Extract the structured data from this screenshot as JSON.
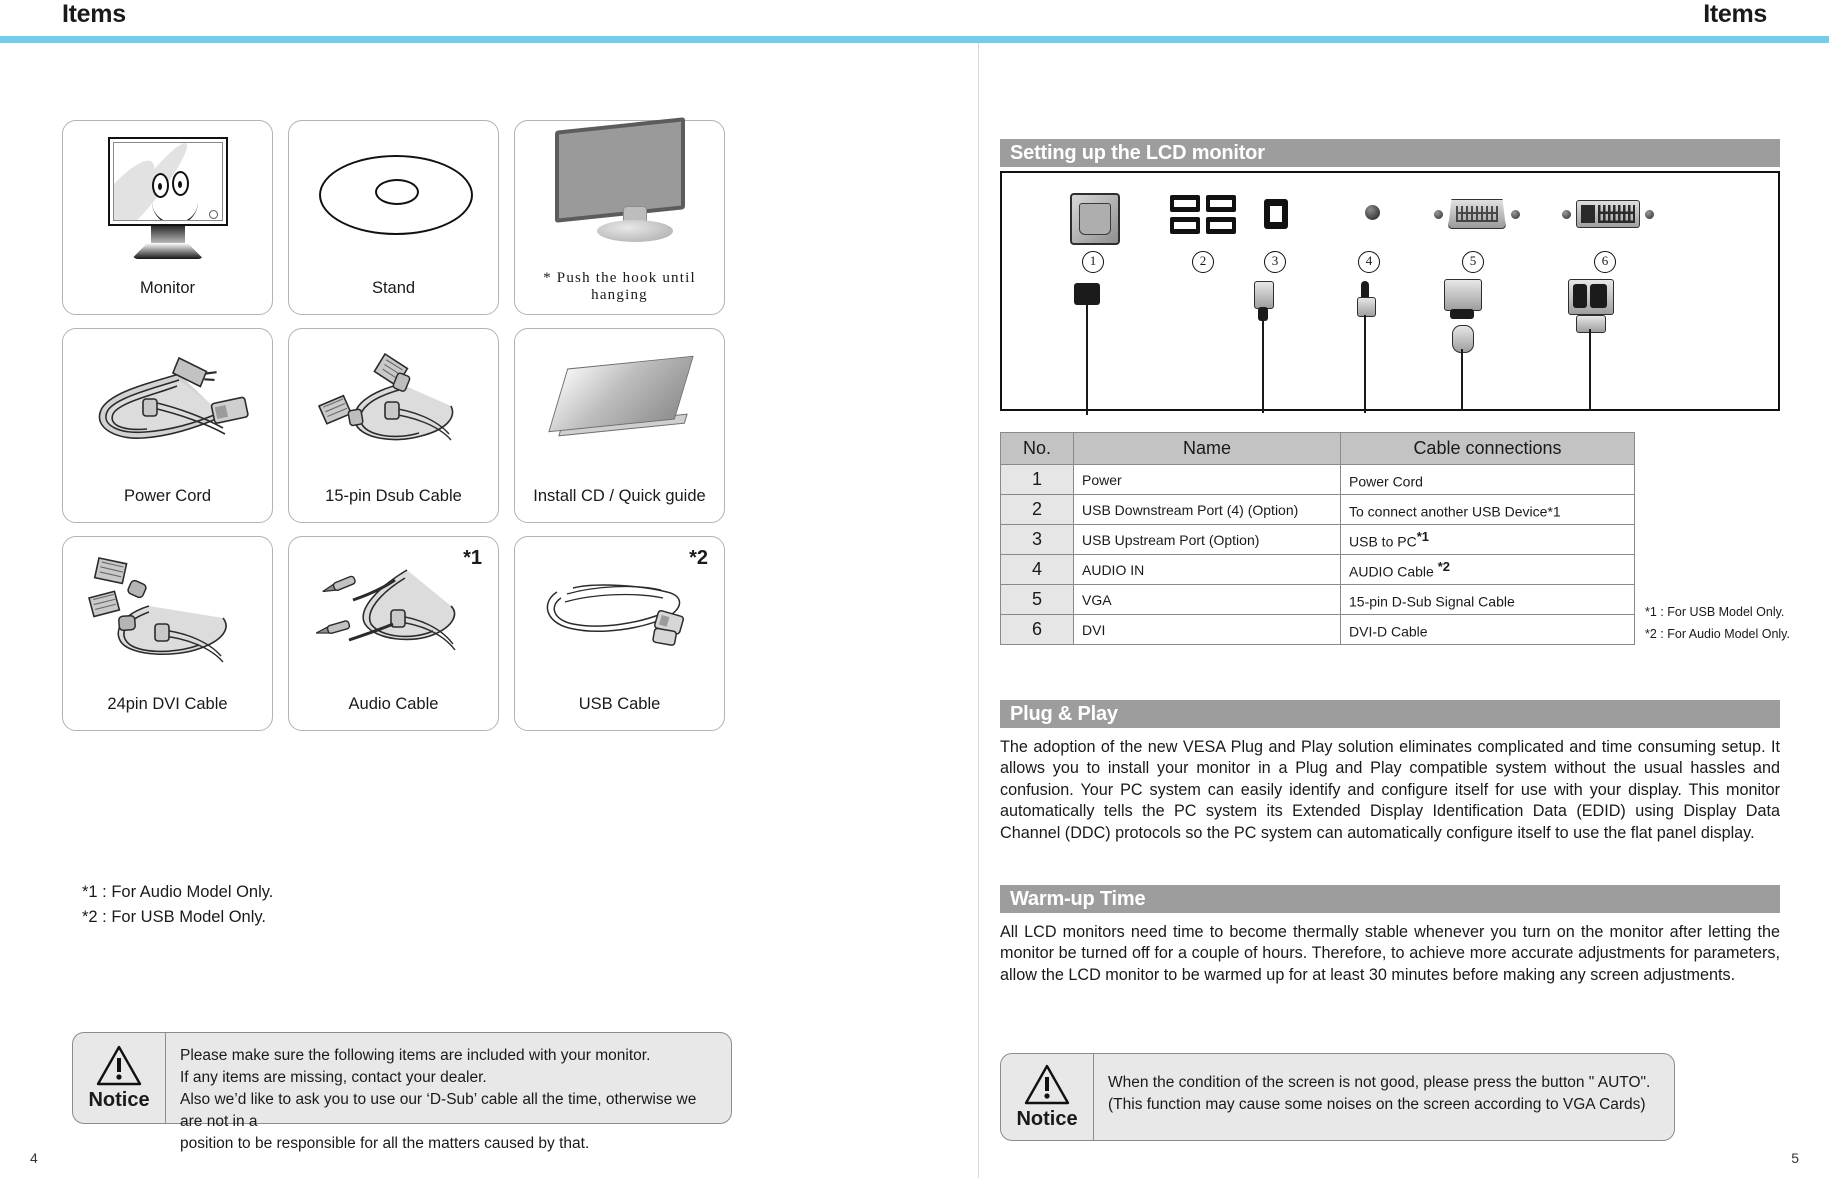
{
  "header": {
    "left_title": "Items",
    "right_title": "Items",
    "rule_color": "#74cdef"
  },
  "page_numbers": {
    "left": "4",
    "right": "5"
  },
  "left_page": {
    "items": [
      {
        "label": "Monitor",
        "art": "monitor-smiley",
        "star": ""
      },
      {
        "label": "Stand",
        "art": "disc",
        "star": ""
      },
      {
        "label": "* Push the hook until\nhanging",
        "art": "monitor-hook",
        "star": "",
        "serif": true
      },
      {
        "label": "Power Cord",
        "art": "power-cord",
        "star": ""
      },
      {
        "label": "15-pin Dsub Cable",
        "art": "dsub-cable",
        "star": ""
      },
      {
        "label": "Install CD / Quick guide",
        "art": "cd-booklet",
        "star": ""
      },
      {
        "label": "24pin DVI Cable",
        "art": "dvi-cable",
        "star": ""
      },
      {
        "label": "Audio Cable",
        "art": "audio-cable",
        "star": "*1"
      },
      {
        "label": "USB Cable",
        "art": "usb-cable",
        "star": "*2"
      }
    ],
    "footnotes": [
      "*1 : For Audio Model Only.",
      "*2 : For USB  Model Only."
    ],
    "notice": {
      "word": "Notice",
      "lines": [
        "Please make sure the following items are included with your monitor.",
        "If any items are missing, contact your dealer.",
        "Also we’d like to ask you to use our ‘D-Sub’ cable all the time, otherwise we are not in a",
        "position to be responsible for all the matters caused by that."
      ]
    }
  },
  "right_page": {
    "setup": {
      "bar_title": "Setting up the LCD monitor",
      "port_numbers": [
        "1",
        "2",
        "3",
        "4",
        "5",
        "6"
      ],
      "port_icons": [
        "ac-inlet",
        "usb-downstream",
        "usb-upstream",
        "audio-jack",
        "vga-dsub",
        "dvi-connector"
      ]
    },
    "table": {
      "headers": [
        "No.",
        "Name",
        "Cable connections"
      ],
      "rows": [
        {
          "no": "1",
          "name": "Power",
          "connection": "Power Cord",
          "sup": ""
        },
        {
          "no": "2",
          "name": "USB Downstream Port (4) (Option)",
          "connection": "To connect another USB Device*1",
          "sup": ""
        },
        {
          "no": "3",
          "name": "USB Upstream Port (Option)",
          "connection": "USB to PC",
          "sup": "*1"
        },
        {
          "no": "4",
          "name": "AUDIO IN",
          "connection": "AUDIO Cable",
          "sup": "*2"
        },
        {
          "no": "5",
          "name": "VGA",
          "connection": "15-pin D-Sub Signal Cable",
          "sup": ""
        },
        {
          "no": "6",
          "name": "DVI",
          "connection": "DVI-D Cable",
          "sup": ""
        }
      ],
      "notes": [
        "*1 : For USB Model Only.",
        "*2 : For Audio Model Only."
      ]
    },
    "plug_and_play": {
      "bar_title": "Plug & Play",
      "text": "The adoption of the new VESA Plug and Play solution eliminates complicated and time consuming setup. It allows you to install your monitor in a Plug and Play compatible system without the usual hassles and confusion. Your PC system can easily identify and configure itself for use with your display. This monitor automatically tells the PC system its Extended Display Identification Data (EDID) using Display Data Channel (DDC) protocols so the PC system can automatically configure itself to use the flat panel display."
    },
    "warm_up": {
      "bar_title": "Warm-up Time",
      "text": " All LCD monitors need time to become thermally stable whenever you turn on the monitor after letting the monitor be turned off for a couple of hours. Therefore, to achieve more accurate adjustments for parameters, allow the LCD monitor to be warmed up for at least 30 minutes before making any screen adjustments."
    },
    "notice": {
      "word": "Notice",
      "lines": [
        "When the condition of the screen is not good, please press the button \" AUTO\".",
        "(This function may cause some noises on the screen according to VGA Cards)"
      ]
    }
  }
}
